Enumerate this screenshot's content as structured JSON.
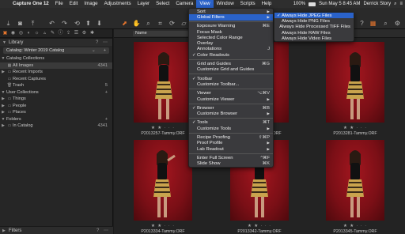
{
  "menubar": {
    "items": [
      "Capture One 12",
      "File",
      "Edit",
      "Image",
      "Adjustments",
      "Layer",
      "Select",
      "Camera",
      "View",
      "Window",
      "Scripts",
      "Help"
    ],
    "active": "View",
    "battery": "100%",
    "clock": "Sun May 5 8:45 AM",
    "user": "Derrick Story"
  },
  "left_panel": {
    "library_title": "Library",
    "catalog_name": "Catalog: Winter 2019 Catalog",
    "catalog_collections_title": "Catalog Collections",
    "catalog_collections": [
      {
        "label": "All Images",
        "count": "4341"
      },
      {
        "label": "Recent Imports",
        "count": ""
      },
      {
        "label": "Recent Captures",
        "count": ""
      },
      {
        "label": "Trash",
        "count": "5"
      }
    ],
    "user_collections_title": "User Collections",
    "user_collections": [
      {
        "label": "Things"
      },
      {
        "label": "People"
      },
      {
        "label": "Places"
      }
    ],
    "folders_title": "Folders",
    "folders": [
      {
        "label": "In Catalog",
        "count": "4341"
      }
    ],
    "filters_title": "Filters",
    "sort_label": "Name"
  },
  "browser": {
    "thumbnails": [
      {
        "name": "P2013257-Tammy.ORF",
        "stars": "★ ★ · · ·"
      },
      {
        "name": "P2013261-Tammy.ORF",
        "stars": "★ ★ · · ·"
      },
      {
        "name": "P2013281-Tammy.ORF",
        "stars": "★ ★ · · ·"
      },
      {
        "name": "P2013334-Tammy.ORF",
        "stars": "★ ★ · · ·"
      },
      {
        "name": "P2013342-Tammy.ORF",
        "stars": "★ ★ · · ·"
      },
      {
        "name": "P2013345-Tammy.ORF",
        "stars": "★ ★ · · ·"
      }
    ]
  },
  "view_menu": {
    "items": [
      {
        "label": "Sort",
        "shortcut": "",
        "check": "",
        "sub": true
      },
      {
        "label": "Global Filters",
        "shortcut": "",
        "check": "",
        "sub": true,
        "highlight": true
      },
      {
        "sep": true
      },
      {
        "label": "Exposure Warning",
        "shortcut": "⌘E",
        "check": ""
      },
      {
        "label": "Focus Mask",
        "shortcut": "",
        "check": ""
      },
      {
        "label": "Selected Color Range",
        "shortcut": "",
        "check": ""
      },
      {
        "label": "Overlay",
        "shortcut": "",
        "check": ""
      },
      {
        "label": "Annotations",
        "shortcut": "J",
        "check": ""
      },
      {
        "label": "Color Readouts",
        "shortcut": "",
        "check": "✓"
      },
      {
        "sep": true
      },
      {
        "label": "Grid and Guides",
        "shortcut": "⌘G",
        "check": ""
      },
      {
        "label": "Customize Grid and Guides",
        "shortcut": "",
        "check": ""
      },
      {
        "sep": true
      },
      {
        "label": "Toolbar",
        "shortcut": "",
        "check": "✓"
      },
      {
        "label": "Customize Toolbar...",
        "shortcut": "",
        "check": ""
      },
      {
        "sep": true
      },
      {
        "label": "Viewer",
        "shortcut": "⌥⌘V",
        "check": ""
      },
      {
        "label": "Customize Viewer",
        "shortcut": "",
        "check": "",
        "sub": true
      },
      {
        "sep": true
      },
      {
        "label": "Browser",
        "shortcut": "⌘B",
        "check": "✓"
      },
      {
        "label": "Customize Browser",
        "shortcut": "",
        "check": "",
        "sub": true
      },
      {
        "sep": true
      },
      {
        "label": "Tools",
        "shortcut": "⌘T",
        "check": "✓"
      },
      {
        "label": "Customize Tools",
        "shortcut": "",
        "check": "",
        "sub": true
      },
      {
        "sep": true
      },
      {
        "label": "Recipe Proofing",
        "shortcut": "⇧⌘P",
        "check": ""
      },
      {
        "label": "Proof Profile",
        "shortcut": "",
        "check": "",
        "sub": true
      },
      {
        "label": "Lab Readout",
        "shortcut": "",
        "check": "",
        "sub": true
      },
      {
        "sep": true
      },
      {
        "label": "Enter Full Screen",
        "shortcut": "^⌘F",
        "check": ""
      },
      {
        "label": "Slide Show",
        "shortcut": "⌘K",
        "check": ""
      }
    ]
  },
  "global_filters_submenu": {
    "items": [
      {
        "label": "Always Hide JPEG Files",
        "check": "✓",
        "highlight": true
      },
      {
        "label": "Always Hide PNG Files",
        "check": ""
      },
      {
        "label": "Always Hide Processed TIFF Files",
        "check": ""
      },
      {
        "label": "Always Hide RAW Files",
        "check": ""
      },
      {
        "label": "Always Hide Video Files",
        "check": ""
      }
    ]
  },
  "colors": {
    "accent": "#2a62c9",
    "photo_red": "#8b1119",
    "panel": "#262626"
  }
}
